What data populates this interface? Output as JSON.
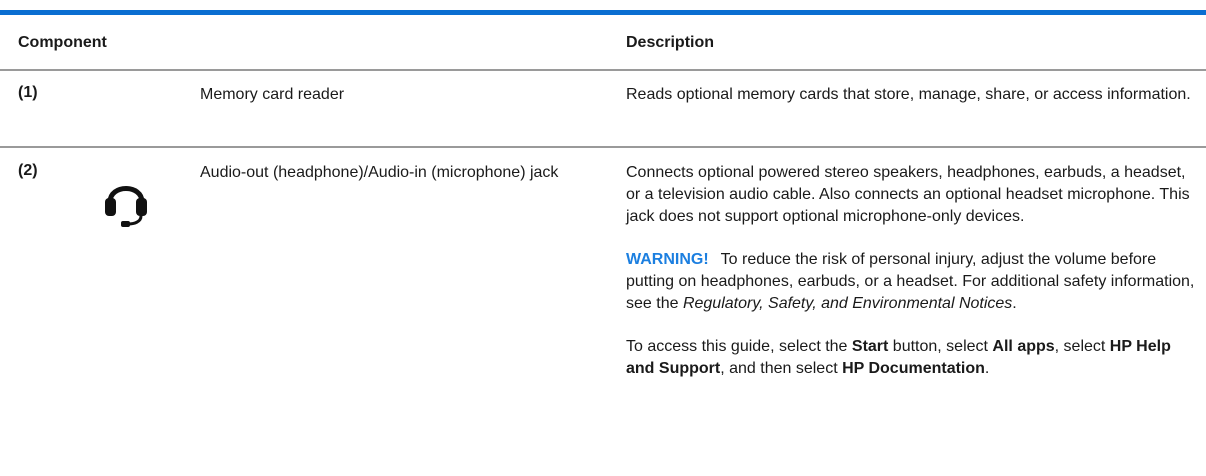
{
  "table": {
    "headers": {
      "component": "Component",
      "description": "Description"
    },
    "rows": [
      {
        "callout": "(1)",
        "name": "Memory card reader",
        "description": "Reads optional memory cards that store, manage, share, or access information."
      },
      {
        "callout": "(2)",
        "icon": "headphone-icon",
        "name": "Audio-out (headphone)/Audio-in (microphone) jack",
        "description": "Connects optional powered stereo speakers, headphones, earbuds, a headset, or a television audio cable. Also connects an optional headset microphone. This jack does not support optional microphone-only devices.",
        "warning": {
          "label": "WARNING!",
          "text_1": "To reduce the risk of personal injury, adjust the volume before putting on headphones, earbuds, or a headset. For additional safety information, see the ",
          "italic": "Regulatory, Safety, and Environmental Notices",
          "text_2": "."
        },
        "guide": {
          "t1": "To access this guide, select the ",
          "b1": "Start",
          "t2": " button, select ",
          "b2": "All apps",
          "t3": ", select ",
          "b3": "HP Help and Support",
          "t4": ", and then select ",
          "b4": "HP Documentation",
          "t5": "."
        }
      }
    ]
  },
  "colors": {
    "top_rule": "#0a6ed1",
    "warning_label": "#1c7fe0",
    "row_rule": "#9a9a9a"
  }
}
